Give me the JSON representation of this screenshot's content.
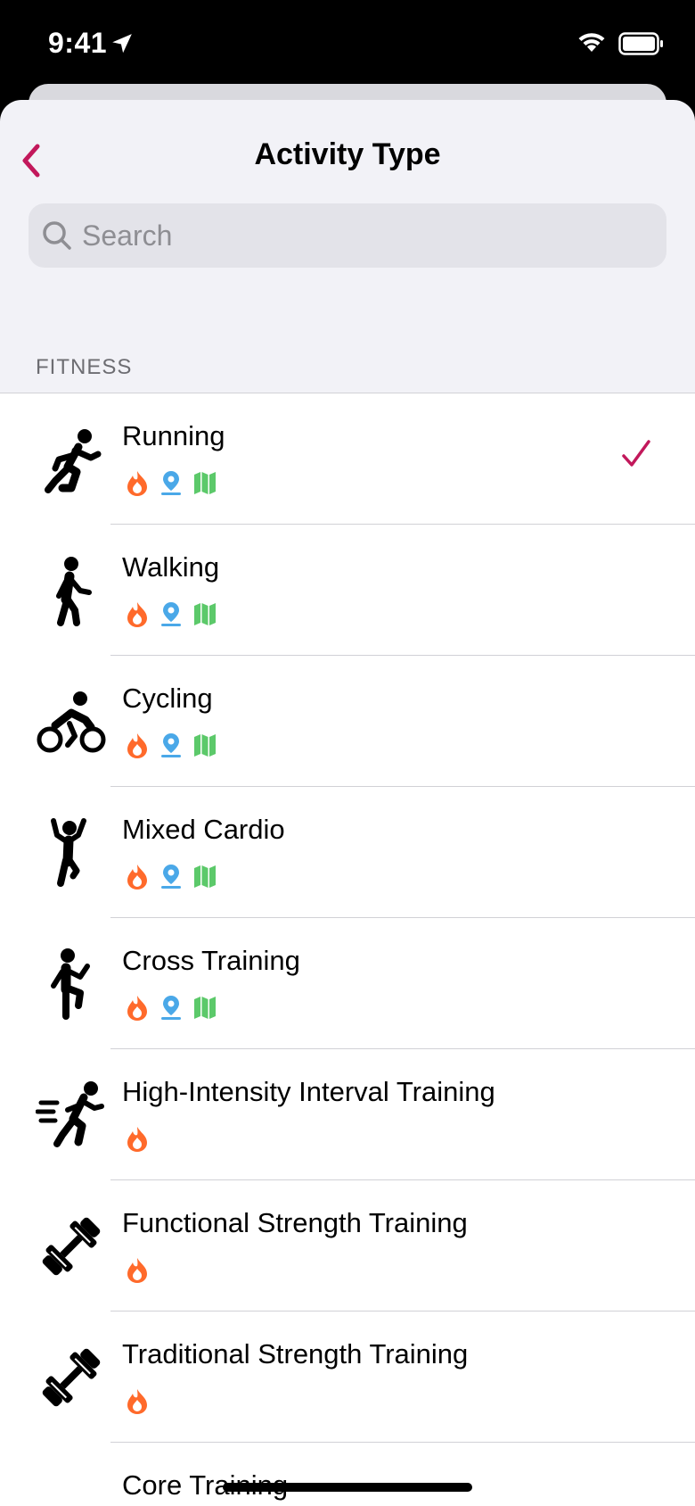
{
  "status_bar": {
    "time": "9:41"
  },
  "header": {
    "title": "Activity Type",
    "back_icon": "chevron-left-icon"
  },
  "search": {
    "placeholder": "Search",
    "value": ""
  },
  "section": {
    "header": "FITNESS"
  },
  "activities": [
    {
      "label": "Running",
      "icon": "running-figure-icon",
      "badges": [
        "flame",
        "location-pin",
        "map"
      ],
      "selected": true
    },
    {
      "label": "Walking",
      "icon": "walking-figure-icon",
      "badges": [
        "flame",
        "location-pin",
        "map"
      ],
      "selected": false
    },
    {
      "label": "Cycling",
      "icon": "cycling-figure-icon",
      "badges": [
        "flame",
        "location-pin",
        "map"
      ],
      "selected": false
    },
    {
      "label": "Mixed Cardio",
      "icon": "mixed-cardio-figure-icon",
      "badges": [
        "flame",
        "location-pin",
        "map"
      ],
      "selected": false
    },
    {
      "label": "Cross Training",
      "icon": "cross-training-figure-icon",
      "badges": [
        "flame",
        "location-pin",
        "map"
      ],
      "selected": false
    },
    {
      "label": "High-Intensity Interval Training",
      "icon": "hiit-figure-icon",
      "badges": [
        "flame"
      ],
      "selected": false
    },
    {
      "label": "Functional Strength Training",
      "icon": "dumbbell-icon",
      "badges": [
        "flame"
      ],
      "selected": false
    },
    {
      "label": "Traditional Strength Training",
      "icon": "dumbbell-icon",
      "badges": [
        "flame"
      ],
      "selected": false
    },
    {
      "label": "Core Training",
      "icon": "core-training-figure-icon",
      "badges": [],
      "selected": false
    }
  ],
  "colors": {
    "accent": "#c2185b",
    "flame": "#ff6a2b",
    "pin": "#4aa8e8",
    "map": "#5cc96a",
    "background": "#f2f2f7"
  }
}
